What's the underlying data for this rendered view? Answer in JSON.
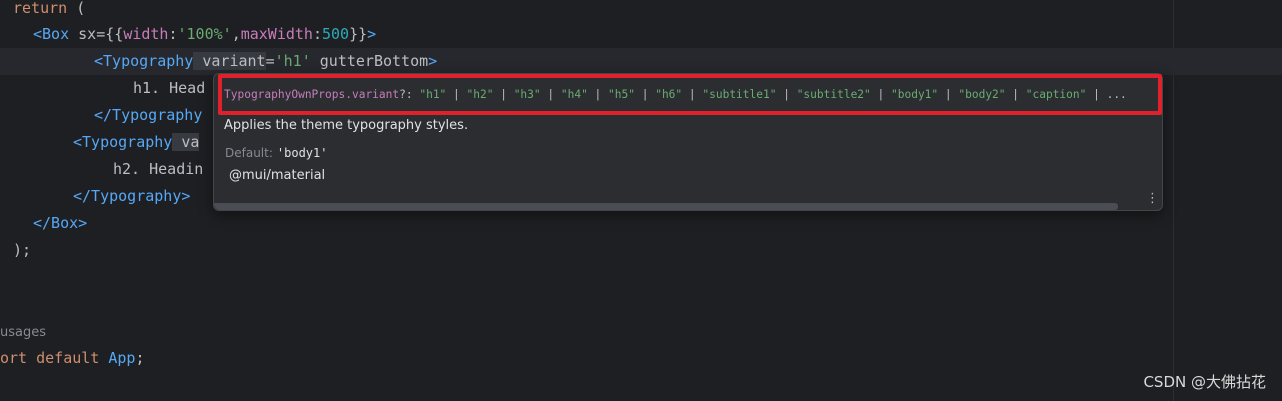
{
  "editor": {
    "lines": [
      {
        "segments": [
          {
            "cls": "kw",
            "text": "return"
          },
          {
            "cls": "plain",
            "text": " ("
          }
        ]
      },
      {
        "segments": [
          {
            "cls": "tag",
            "text": "<Box"
          },
          {
            "cls": "attr",
            "text": " sx"
          },
          {
            "cls": "plain",
            "text": "={{"
          },
          {
            "cls": "prop",
            "text": "width"
          },
          {
            "cls": "plain",
            "text": ":"
          },
          {
            "cls": "str",
            "text": "'100%'"
          },
          {
            "cls": "plain",
            "text": ","
          },
          {
            "cls": "prop",
            "text": "maxWidth"
          },
          {
            "cls": "plain",
            "text": ":"
          },
          {
            "cls": "num",
            "text": "500"
          },
          {
            "cls": "plain",
            "text": "}}"
          },
          {
            "cls": "tag",
            "text": ">"
          }
        ]
      },
      {
        "segments": [
          {
            "cls": "tag",
            "text": "<Typography"
          },
          {
            "cls": "attr sel-bg",
            "text": " variant"
          },
          {
            "cls": "plain",
            "text": "="
          },
          {
            "cls": "str",
            "text": "'h1'"
          },
          {
            "cls": "attr",
            "text": " gutterBottom"
          },
          {
            "cls": "tag",
            "text": ">"
          }
        ]
      },
      {
        "segments": [
          {
            "cls": "plain",
            "text": "h1. Head"
          }
        ]
      },
      {
        "segments": [
          {
            "cls": "tag",
            "text": "</Typography"
          }
        ]
      },
      {
        "segments": [
          {
            "cls": "tag",
            "text": "<Typography"
          },
          {
            "cls": "attr sel-bg",
            "text": " va"
          }
        ]
      },
      {
        "segments": [
          {
            "cls": "plain",
            "text": "h2. Headin"
          }
        ]
      },
      {
        "segments": [
          {
            "cls": "tag",
            "text": "</Typography>"
          }
        ]
      },
      {
        "segments": [
          {
            "cls": "tag",
            "text": "</Box>"
          }
        ]
      },
      {
        "segments": [
          {
            "cls": "plain",
            "text": ");"
          }
        ]
      },
      {
        "segments": []
      },
      {
        "segments": [
          {
            "cls": "kw",
            "text": "ort default"
          },
          {
            "cls": "plain",
            "text": " "
          },
          {
            "cls": "fn",
            "text": "App"
          },
          {
            "cls": "plain",
            "text": ";"
          }
        ]
      }
    ],
    "usages_hint": "usages"
  },
  "popup": {
    "signature": [
      {
        "cls": "sig-type",
        "text": "TypographyOwnProps.variant"
      },
      {
        "cls": "sig-op",
        "text": "?: "
      },
      {
        "cls": "sig-str",
        "text": "\"h1\""
      },
      {
        "cls": "sig-op",
        "text": " | "
      },
      {
        "cls": "sig-str",
        "text": "\"h2\""
      },
      {
        "cls": "sig-op",
        "text": " | "
      },
      {
        "cls": "sig-str",
        "text": "\"h3\""
      },
      {
        "cls": "sig-op",
        "text": " | "
      },
      {
        "cls": "sig-str",
        "text": "\"h4\""
      },
      {
        "cls": "sig-op",
        "text": " | "
      },
      {
        "cls": "sig-str",
        "text": "\"h5\""
      },
      {
        "cls": "sig-op",
        "text": " | "
      },
      {
        "cls": "sig-str",
        "text": "\"h6\""
      },
      {
        "cls": "sig-op",
        "text": " | "
      },
      {
        "cls": "sig-str",
        "text": "\"subtitle1\""
      },
      {
        "cls": "sig-op",
        "text": " | "
      },
      {
        "cls": "sig-str",
        "text": "\"subtitle2\""
      },
      {
        "cls": "sig-op",
        "text": " | "
      },
      {
        "cls": "sig-str",
        "text": "\"body1\""
      },
      {
        "cls": "sig-op",
        "text": " | "
      },
      {
        "cls": "sig-str",
        "text": "\"body2\""
      },
      {
        "cls": "sig-op",
        "text": " | "
      },
      {
        "cls": "sig-str",
        "text": "\"caption\""
      },
      {
        "cls": "sig-op",
        "text": " | ..."
      }
    ],
    "description": "Applies the theme typography styles.",
    "default_label": "Default:",
    "default_value": "'body1'",
    "package": "@mui/material",
    "menu_icon": "more-vertical-icon"
  },
  "watermark": "CSDN @大佛拈花",
  "colors": {
    "editor_bg": "#1e1f22",
    "popup_bg": "#2b2d30",
    "highlight_red": "#e0202a",
    "keyword": "#cf8e6d",
    "tag": "#56a8f5",
    "string": "#6aab73",
    "property": "#c77dbb",
    "number": "#2aacb8"
  }
}
